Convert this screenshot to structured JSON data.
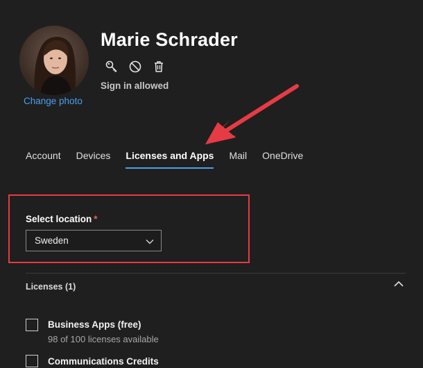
{
  "user": {
    "name": "Marie Schrader",
    "change_photo": "Change photo",
    "signin_status": "Sign in allowed",
    "actions": [
      "key-icon",
      "block-icon",
      "trash-icon"
    ]
  },
  "tabs": [
    {
      "label": "Account",
      "active": false
    },
    {
      "label": "Devices",
      "active": false
    },
    {
      "label": "Licenses and Apps",
      "active": true
    },
    {
      "label": "Mail",
      "active": false
    },
    {
      "label": "OneDrive",
      "active": false
    }
  ],
  "location": {
    "label": "Select location",
    "required_marker": "*",
    "value": "Sweden"
  },
  "licenses": {
    "header": "Licenses (1)",
    "expanded": true,
    "items": [
      {
        "name": "Business Apps (free)",
        "availability": "98 of 100 licenses available",
        "checked": false
      },
      {
        "name": "Communications Credits",
        "checked": false
      }
    ]
  },
  "colors": {
    "background": "#1f1f1f",
    "accent": "#4aa0f0",
    "annotation": "#e63b45"
  }
}
